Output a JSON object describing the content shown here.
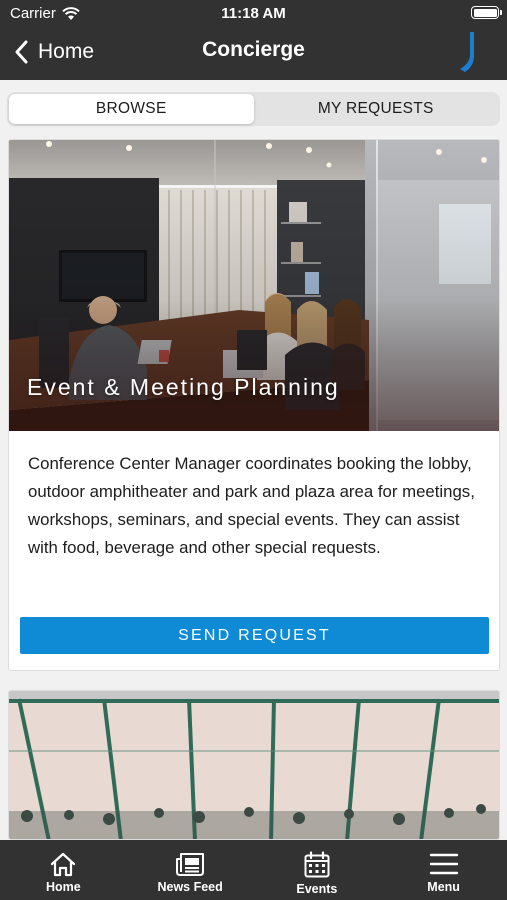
{
  "status_bar": {
    "carrier": "Carrier",
    "time": "11:18 AM",
    "icons": [
      "wifi-icon",
      "battery-icon"
    ]
  },
  "nav": {
    "back_label": "Home",
    "title": "Concierge",
    "brand_icon": "j-logo-icon"
  },
  "segments": [
    {
      "label": "BROWSE",
      "selected": true
    },
    {
      "label": "MY REQUESTS",
      "selected": false
    }
  ],
  "cards": [
    {
      "photo_caption": "Event & Meeting Planning",
      "description": "Conference Center Manager coordinates booking the lobby, outdoor amphitheater and park and plaza area for meetings, workshops, seminars, and special events. They can assist with food, beverage and other special requests.",
      "button_label": "SEND REQUEST"
    }
  ],
  "tabbar": {
    "items": [
      {
        "label": "Home",
        "icon": "house-icon"
      },
      {
        "label": "News Feed",
        "icon": "newspaper-icon"
      },
      {
        "label": "Events",
        "icon": "calendar-icon"
      },
      {
        "label": "Menu",
        "icon": "hamburger-menu-icon"
      }
    ]
  },
  "colors": {
    "bar_background": "#323232",
    "accent_blue": "#0f8bd6",
    "brand_blue": "#1a7fd1",
    "page_background": "#f1f1f1"
  }
}
